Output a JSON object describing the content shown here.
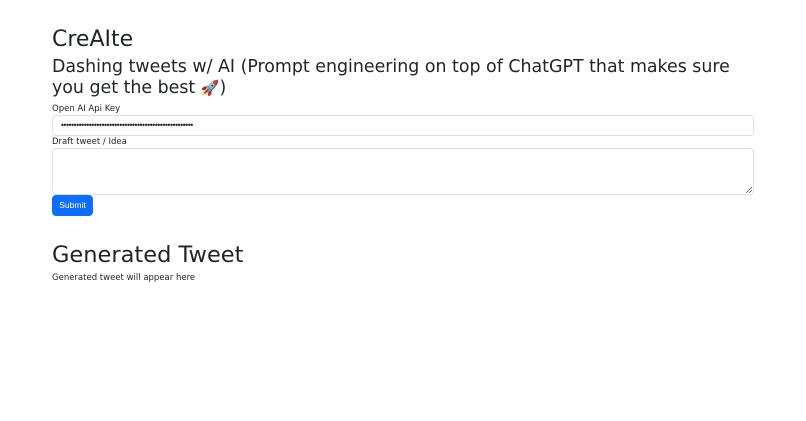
{
  "app": {
    "title": "CreAIte",
    "subtitle_text": "Dashing tweets w/ AI (Prompt engineering on top of ChatGPT that makes sure you get the best ",
    "subtitle_emoji": "🚀",
    "subtitle_close": ")"
  },
  "form": {
    "api_key_label": "Open AI Api Key",
    "api_key_masked": "••••••••••••••••••••••••••••••••••••••••••••••••••••",
    "draft_label": "Draft tweet / Idea",
    "draft_value": "",
    "submit_label": "Submit"
  },
  "output": {
    "heading": "Generated Tweet",
    "placeholder_text": "Generated tweet will appear here"
  },
  "colors": {
    "primary": "#0d6efd",
    "text": "#212529",
    "border": "#dee2e6"
  },
  "icons": {
    "rocket": "rocket-icon",
    "resize": "resize-grip-icon"
  }
}
